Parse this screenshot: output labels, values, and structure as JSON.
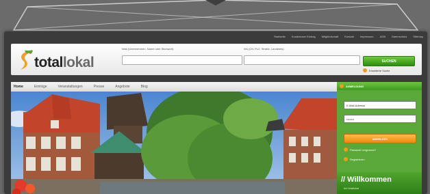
{
  "top_nav": {
    "links": [
      "Startseite",
      "Kostenloser Eintrag",
      "Mitgliedschaft",
      "Kontakt",
      "Impressum",
      "AGB",
      "Datenschutz",
      "Sitemap"
    ]
  },
  "logo": {
    "text_part1": "total",
    "text_part2": "lokal"
  },
  "search": {
    "what_label": "Was (Unternehmen, Name oder Stichwort)",
    "where_label": "Wo (Ort, PLZ, Straße, Landkreis)",
    "what_value": "",
    "where_value": "",
    "button_label": "SUCHEN",
    "advanced_label": "Erweiterte Suche"
  },
  "tabs": [
    "Home",
    "Einträge",
    "Veranstaltungen",
    "Presse",
    "Angebote",
    "Blog"
  ],
  "login": {
    "title": "ANMELDUNG",
    "email_value": "E-Mail-Adresse",
    "password_value": "••••••••",
    "button_label": "ANMELDEN",
    "forgot_label": "Passwort vergessen?",
    "register_label": "Registrieren"
  },
  "welcome": {
    "title": "// Willkommen",
    "subtitle": "bei totallokal"
  },
  "colors": {
    "brand_green": "#3c8f22",
    "brand_orange": "#f29a1e",
    "background": "#6b6b6b"
  }
}
